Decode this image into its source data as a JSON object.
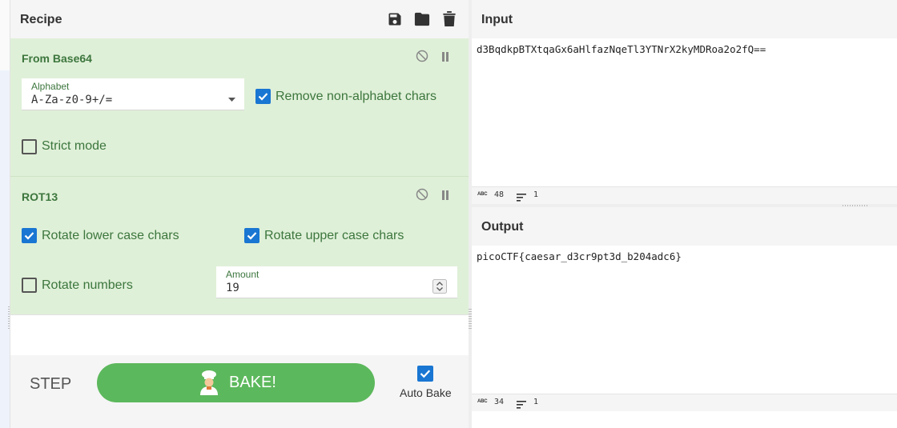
{
  "recipe": {
    "title": "Recipe",
    "icons": [
      "save-icon",
      "folder-icon",
      "trash-icon"
    ],
    "operations": [
      {
        "name": "From Base64",
        "alphabet_label": "Alphabet",
        "alphabet_value": "A-Za-z0-9+/=",
        "remove_label": "Remove non-alphabet chars",
        "remove_checked": true,
        "strict_label": "Strict mode",
        "strict_checked": false
      },
      {
        "name": "ROT13",
        "lower_label": "Rotate lower case chars",
        "lower_checked": true,
        "upper_label": "Rotate upper case chars",
        "upper_checked": true,
        "numbers_label": "Rotate numbers",
        "numbers_checked": false,
        "amount_label": "Amount",
        "amount_value": "19"
      }
    ]
  },
  "controls": {
    "step_label": "STEP",
    "bake_label": "BAKE!",
    "auto_bake_label": "Auto Bake",
    "auto_bake_checked": true
  },
  "input": {
    "title": "Input",
    "text": "d3BqdkpBTXtqaGx6aHlfazNqeTl3YTNrX2kyMDRoa2o2fQ==",
    "length": "48",
    "lines": "1"
  },
  "output": {
    "title": "Output",
    "text": "picoCTF{caesar_d3cr9pt3d_b204adc6}",
    "length": "34",
    "lines": "1"
  },
  "colors": {
    "op_bg": "#dff0d8",
    "op_text": "#3c763d",
    "checkbox": "#1976d2",
    "bake": "#5cb85c"
  }
}
